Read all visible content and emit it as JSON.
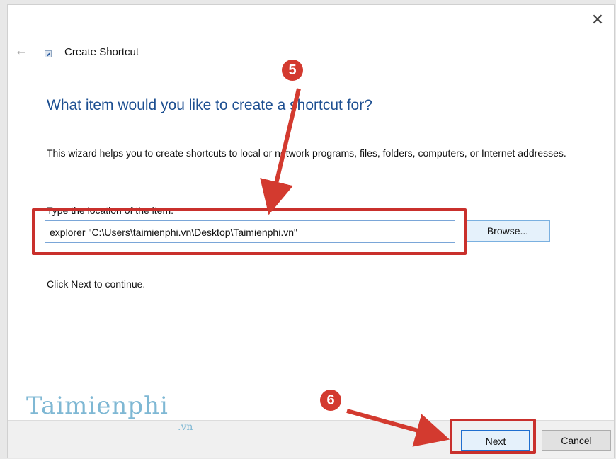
{
  "window": {
    "close_icon": "close-icon",
    "back_icon": "back-arrow-icon",
    "title": "Create Shortcut"
  },
  "main": {
    "heading": "What item would you like to create a shortcut for?",
    "description": "This wizard helps you to create shortcuts to local or network programs, files, folders, computers, or Internet addresses.",
    "location_label": "Type the location of the item:",
    "location_value": "explorer \"C:\\Users\\taimienphi.vn\\Desktop\\Taimienphi.vn\"",
    "browse_label": "Browse...",
    "continue_text": "Click Next to continue."
  },
  "footer": {
    "next_label": "Next",
    "cancel_label": "Cancel"
  },
  "annotations": {
    "step5": "5",
    "step6": "6",
    "highlight_color": "#c9302c"
  },
  "watermark": {
    "brand": "Taimienphi",
    "suffix": ".vn"
  }
}
